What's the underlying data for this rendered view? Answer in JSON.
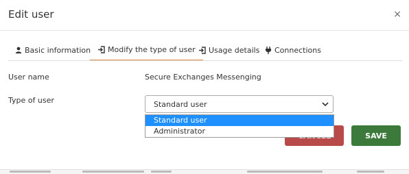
{
  "dialog": {
    "title": "Edit user",
    "close_glyph": "×"
  },
  "tabs": [
    {
      "label": "Basic information",
      "icon": "user-icon",
      "active": false
    },
    {
      "label": "Modify the type of user",
      "icon": "sign-in-icon",
      "active": true
    },
    {
      "label": "Usage details",
      "icon": "sign-in-icon",
      "active": false
    },
    {
      "label": "Connections",
      "icon": "plug-icon",
      "active": false
    }
  ],
  "form": {
    "username_label": "User name",
    "username_value": "Secure Exchanges Messenging",
    "type_label": "Type of user",
    "type_selected": "Standard user",
    "type_options": [
      "Standard user",
      "Administrator"
    ]
  },
  "buttons": {
    "cancel_label": "CANCEL",
    "save_label": "SAVE"
  },
  "colors": {
    "active_tab_underline": "#d98b4a",
    "cancel": "#b84a4a",
    "save": "#3b7a3b",
    "option_highlight": "#1e90ff"
  }
}
